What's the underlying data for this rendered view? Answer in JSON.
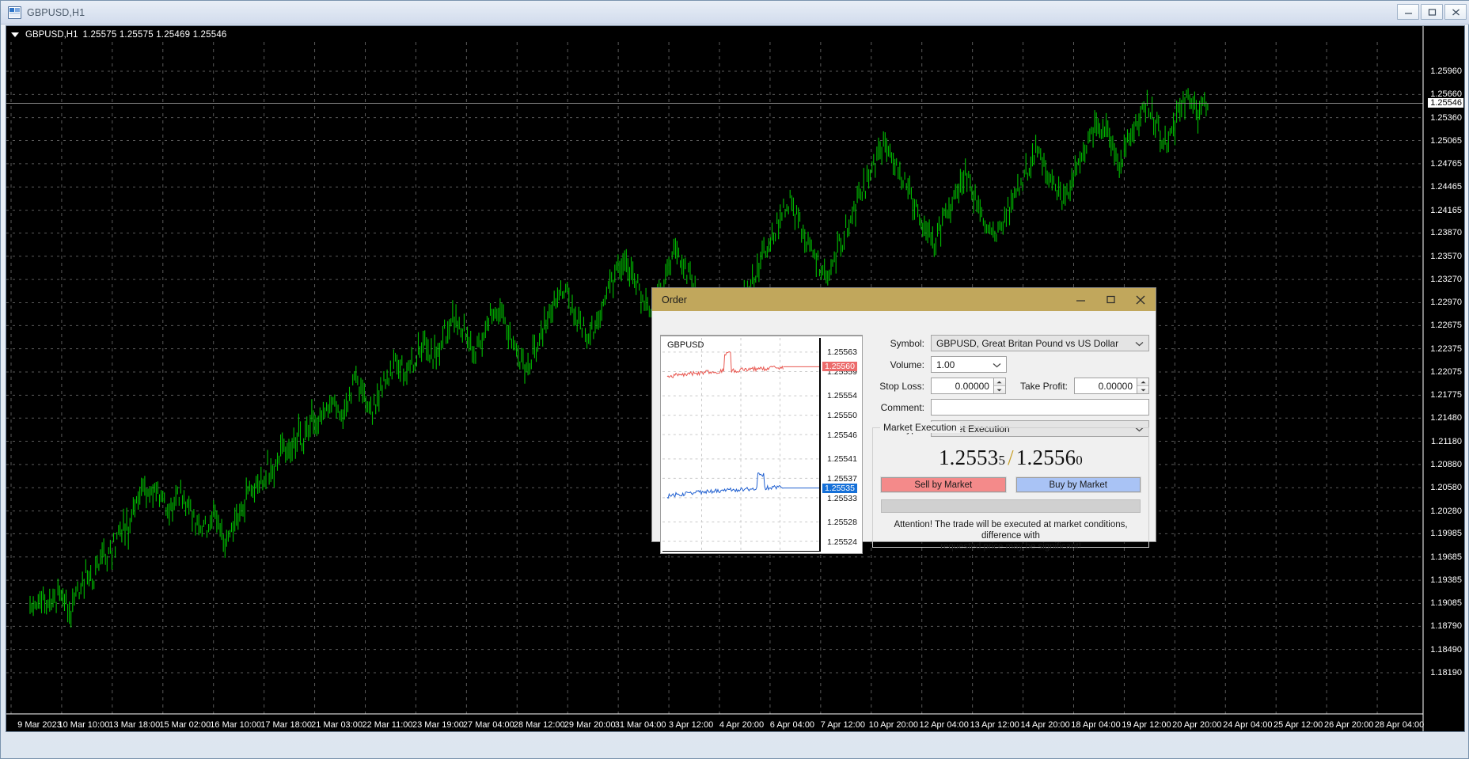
{
  "window": {
    "title": "GBPUSD,H1",
    "icon": "chart-window-icon",
    "minimize_label": "–",
    "maximize_label": "□",
    "close_label": "✕"
  },
  "chart": {
    "header": {
      "symbol_period": "GBPUSD,H1",
      "ohlc": "1.25575 1.25575 1.25469 1.25546",
      "open": "1.25575",
      "high": "1.25575",
      "low": "1.25469",
      "close": "1.25546"
    },
    "current_price": "1.25546",
    "background_color": "#000000",
    "line_color": "#00c000",
    "grid_color": "#555555"
  },
  "chart_data": {
    "type": "line",
    "title": "GBPUSD,H1",
    "xlabel": "",
    "ylabel": "",
    "ylim": [
      1.1819,
      1.2611
    ],
    "grid": true,
    "legend": "none",
    "price_ticks": [
      "1.25960",
      "1.25660",
      "1.25360",
      "1.25065",
      "1.24765",
      "1.24465",
      "1.24165",
      "1.23870",
      "1.23570",
      "1.23270",
      "1.22970",
      "1.22675",
      "1.22375",
      "1.22075",
      "1.21775",
      "1.21480",
      "1.21180",
      "1.20880",
      "1.20580",
      "1.20280",
      "1.19985",
      "1.19685",
      "1.19385",
      "1.19085",
      "1.18790",
      "1.18490",
      "1.18190"
    ],
    "price_tick_values": [
      1.2596,
      1.2566,
      1.2536,
      1.25065,
      1.24765,
      1.24465,
      1.24165,
      1.2387,
      1.2357,
      1.2327,
      1.2297,
      1.22675,
      1.22375,
      1.22075,
      1.21775,
      1.2148,
      1.2118,
      1.2088,
      1.2058,
      1.2028,
      1.19985,
      1.19685,
      1.19385,
      1.19085,
      1.1879,
      1.1849,
      1.1819
    ],
    "time_ticks": [
      "9 Mar 2023",
      "10 Mar 10:00",
      "13 Mar 18:00",
      "15 Mar 02:00",
      "16 Mar 10:00",
      "17 Mar 18:00",
      "21 Mar 03:00",
      "22 Mar 11:00",
      "23 Mar 19:00",
      "27 Mar 04:00",
      "28 Mar 12:00",
      "29 Mar 20:00",
      "31 Mar 04:00",
      "3 Apr 12:00",
      "4 Apr 20:00",
      "6 Apr 04:00",
      "7 Apr 12:00",
      "10 Apr 20:00",
      "12 Apr 04:00",
      "13 Apr 12:00",
      "14 Apr 20:00",
      "18 Apr 04:00",
      "19 Apr 12:00",
      "20 Apr 20:00",
      "24 Apr 04:00",
      "25 Apr 12:00",
      "26 Apr 20:00",
      "28 Apr 04:00"
    ],
    "series": [
      {
        "name": "GBPUSD",
        "values": [
          1.1914,
          1.1908,
          1.1921,
          1.1903,
          1.1898,
          1.1912,
          1.1926,
          1.1909,
          1.1895,
          1.1918,
          1.1932,
          1.1947,
          1.1938,
          1.1955,
          1.1971,
          1.1962,
          1.1978,
          1.1994,
          1.2012,
          1.2003,
          1.2021,
          1.2038,
          1.2055,
          1.2042,
          1.2061,
          1.2049,
          1.2032,
          1.2018,
          1.2036,
          1.2052,
          1.2041,
          1.2025,
          1.2008,
          1.1992,
          1.2006,
          1.2021,
          1.2014,
          1.1998,
          1.1982,
          1.1996,
          1.2011,
          1.2028,
          1.2045,
          1.2062,
          1.2051,
          1.2068,
          1.2085,
          1.2073,
          1.2091,
          1.2108,
          1.2096,
          1.2112,
          1.2129,
          1.2118,
          1.2135,
          1.2151,
          1.2142,
          1.2158,
          1.2172,
          1.2161,
          1.2149,
          1.2163,
          1.2178,
          1.2192,
          1.2181,
          1.2167,
          1.2152,
          1.2168,
          1.2183,
          1.2197,
          1.2211,
          1.2226,
          1.2214,
          1.2201,
          1.2218,
          1.2232,
          1.2246,
          1.2235,
          1.2221,
          1.2238,
          1.2252,
          1.2268,
          1.2281,
          1.2272,
          1.2258,
          1.2243,
          1.2229,
          1.2245,
          1.2261,
          1.2278,
          1.2292,
          1.2281,
          1.2266,
          1.2251,
          1.2238,
          1.2222,
          1.2209,
          1.2224,
          1.2241,
          1.2258,
          1.2272,
          1.2289,
          1.2302,
          1.2318,
          1.2305,
          1.2291,
          1.2276,
          1.2262,
          1.2248,
          1.2264,
          1.2281,
          1.2298,
          1.2312,
          1.2328,
          1.2341,
          1.2356,
          1.2342,
          1.2327,
          1.2311,
          1.2296,
          1.2282,
          1.2298,
          1.2314,
          1.2331,
          1.2348,
          1.2362,
          1.2351,
          1.2336,
          1.2322,
          1.2308,
          1.2294,
          1.2279,
          1.2264,
          1.2248,
          1.2232,
          1.2246,
          1.2262,
          1.2278,
          1.2295,
          1.2311,
          1.2328,
          1.2344,
          1.2359,
          1.2372,
          1.2386,
          1.2401,
          1.2415,
          1.2428,
          1.2412,
          1.2396,
          1.2381,
          1.2366,
          1.2352,
          1.2338,
          1.2324,
          1.2341,
          1.2358,
          1.2374,
          1.2391,
          1.2408,
          1.2422,
          1.2436,
          1.2451,
          1.2464,
          1.2478,
          1.2492,
          1.2505,
          1.2489,
          1.2472,
          1.2456,
          1.2441,
          1.2427,
          1.2412,
          1.2398,
          1.2384,
          1.2371,
          1.2386,
          1.2402,
          1.2418,
          1.2433,
          1.2447,
          1.2462,
          1.2448,
          1.2433,
          1.2419,
          1.2404,
          1.2391,
          1.2377,
          1.2392,
          1.2408,
          1.2424,
          1.2439,
          1.2454,
          1.2468,
          1.2482,
          1.2496,
          1.2481,
          1.2466,
          1.2452,
          1.2438,
          1.2424,
          1.2441,
          1.2457,
          1.2472,
          1.2488,
          1.2502,
          1.2516,
          1.2531,
          1.2518,
          1.2504,
          1.2491,
          1.2477,
          1.2492,
          1.2508,
          1.2523,
          1.2538,
          1.2552,
          1.2541,
          1.2528,
          1.2514,
          1.2501,
          1.2516,
          1.2532,
          1.2547,
          1.2555,
          1.2548,
          1.2541,
          1.2552,
          1.25546
        ]
      }
    ]
  },
  "order_dialog": {
    "title": "Order",
    "minimize_label": "–",
    "maximize_label": "□",
    "close_label": "✕",
    "titlebar_color": "#c1a75c",
    "mini_chart": {
      "symbol": "GBPUSD",
      "bid_tag": "1.25560",
      "ask_tag": "1.25535",
      "price_ticks": [
        "1.25563",
        "1.25559",
        "1.25554",
        "1.25550",
        "1.25546",
        "1.25541",
        "1.25537",
        "1.25533",
        "1.25528",
        "1.25524"
      ],
      "bid_color": "#e8564f",
      "ask_color": "#1f5fd0"
    },
    "fields": {
      "symbol_label": "Symbol:",
      "symbol_value": "GBPUSD, Great Britan Pound vs US Dollar",
      "volume_label": "Volume:",
      "volume_value": "1.00",
      "stop_loss_label": "Stop Loss:",
      "stop_loss_value": "0.00000",
      "take_profit_label": "Take Profit:",
      "take_profit_value": "0.00000",
      "comment_label": "Comment:",
      "comment_value": "",
      "comment_placeholder": "",
      "type_label": "Type:",
      "type_value": "Market Execution"
    },
    "execution": {
      "group_title": "Market Execution",
      "bid_main": "1.2553",
      "bid_last": "5",
      "separator": "/",
      "ask_main": "1.2556",
      "ask_last": "0",
      "sell_button": "Sell by Market",
      "buy_button": "Buy by Market",
      "warning_line1": "Attention! The trade will be executed at market conditions, difference with",
      "warning_line2": "requested price may be significant!",
      "sell_color": "#f48a8a",
      "buy_color": "#a9c3f5"
    }
  }
}
